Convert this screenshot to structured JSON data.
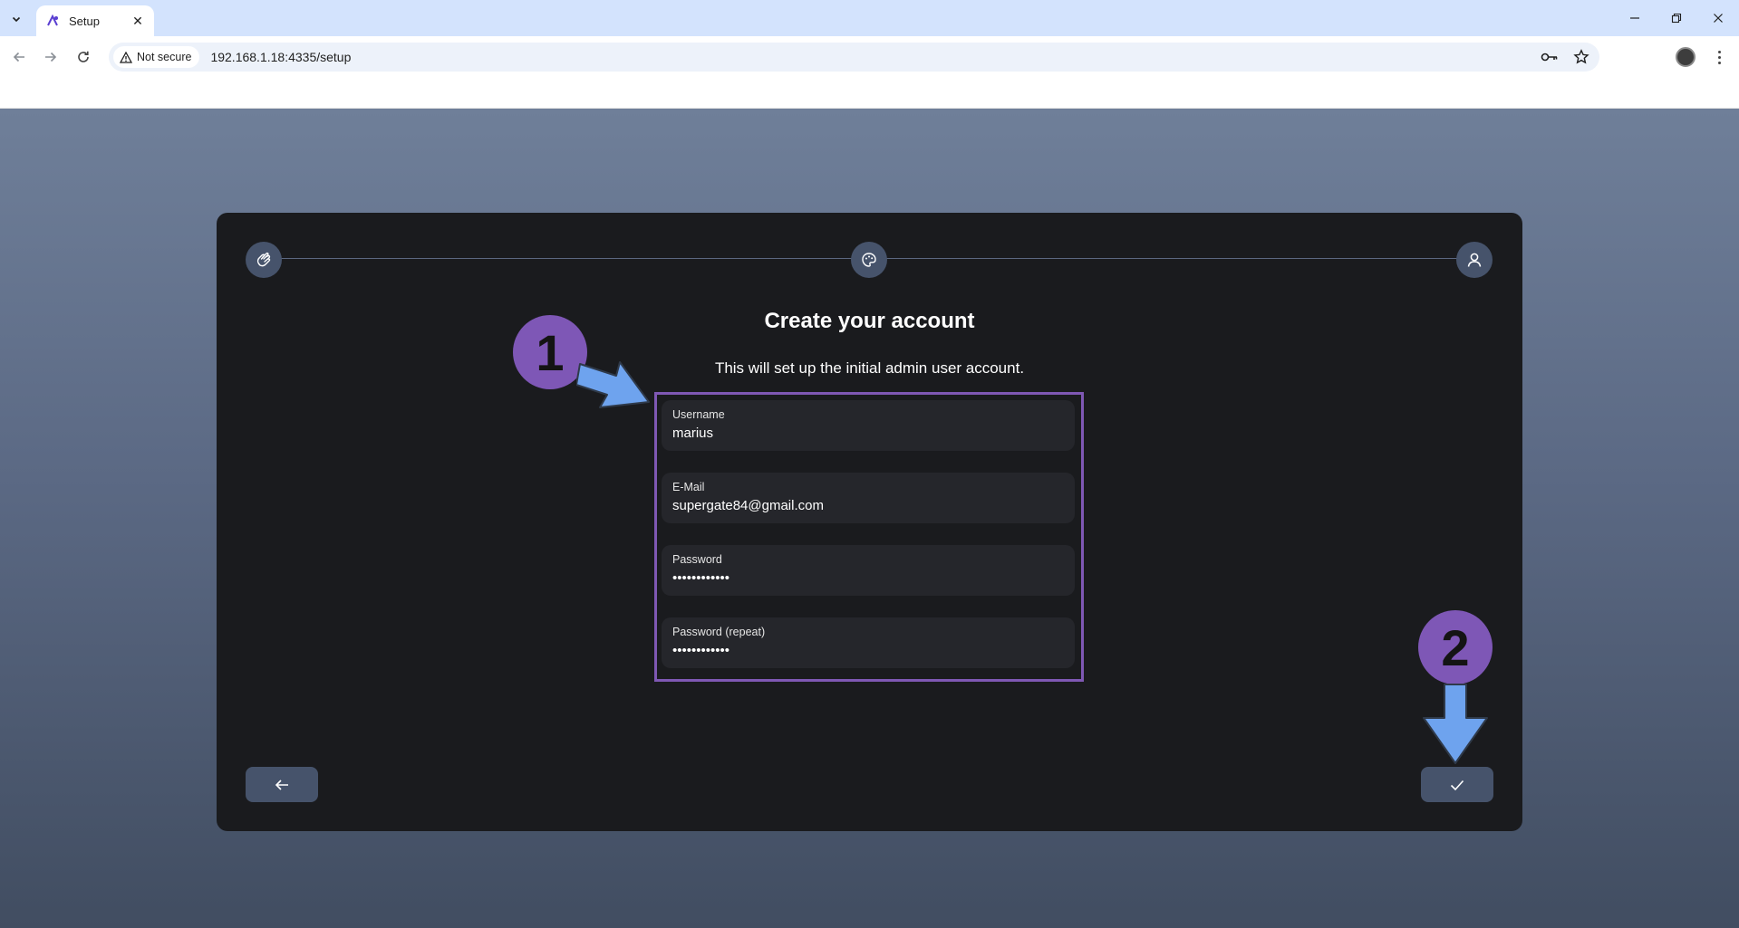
{
  "browser": {
    "tab": {
      "title": "Setup",
      "close_glyph": "✕"
    },
    "tab_list_glyph": "⌄",
    "window_controls": {
      "minimize": "—",
      "restore": "❐",
      "close": "✕"
    },
    "nav": {
      "back": "←",
      "forward": "→",
      "reload": "↻"
    },
    "security_label": "Not secure",
    "url": "192.168.1.18:4335/setup",
    "icons": [
      "password-key-icon",
      "bookmark-star-icon",
      "profile-avatar",
      "browser-menu-icon"
    ]
  },
  "setup": {
    "heading": "Create your account",
    "subtitle": "This will set up the initial admin user account.",
    "steps": [
      "wave-hand-icon",
      "palette-icon",
      "user-icon"
    ],
    "fields": {
      "username": {
        "label": "Username",
        "value": "marius"
      },
      "email": {
        "label": "E-Mail",
        "value": "supergate84@gmail.com"
      },
      "password": {
        "label": "Password",
        "value": "••••••••••••"
      },
      "password_repeat": {
        "label": "Password (repeat)",
        "value": "••••••••••••"
      }
    },
    "back_button_icon": "arrow-left-icon",
    "submit_button_icon": "check-icon"
  },
  "annotations": {
    "badge_1": "1",
    "badge_2": "2",
    "highlight_color": "#7f58b4",
    "arrow_color": "#6ea3ee"
  },
  "colors": {
    "card_background": "#1a1b1e",
    "field_background": "#25262b",
    "step_circle": "#46536b",
    "tabbar": "#d3e3fd"
  }
}
